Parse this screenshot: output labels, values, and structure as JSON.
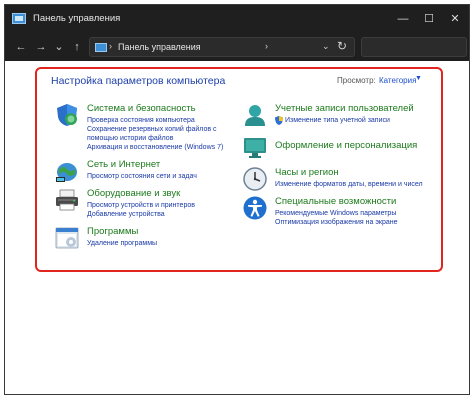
{
  "window": {
    "title": "Панель управления",
    "minimize_glyph": "—",
    "maximize_glyph": "☐",
    "close_glyph": "✕"
  },
  "nav": {
    "back_glyph": "←",
    "forward_glyph": "→",
    "recent_glyph": "⌄",
    "up_glyph": "↑",
    "breadcrumb": "Панель управления",
    "separator": "›",
    "dropdown_glyph": "⌄",
    "refresh_glyph": "↻"
  },
  "content": {
    "title": "Настройка параметров компьютера",
    "view_label": "Просмотр:",
    "view_value": "Категория",
    "view_arrow": "▼",
    "accent_color": "#e0261f"
  },
  "categories_left": [
    {
      "name": "system-security",
      "icon": "shield-icon",
      "title": "Система и безопасность",
      "links": [
        "Проверка состояния компьютера",
        "Сохранение резервных копий файлов с",
        "помощью истории файлов",
        "Архивация и восстановление (Windows 7)"
      ]
    },
    {
      "name": "network-internet",
      "icon": "network-icon",
      "title": "Сеть и Интернет",
      "links": [
        "Просмотр состояния сети и задач"
      ]
    },
    {
      "name": "hardware-sound",
      "icon": "printer-icon",
      "title": "Оборудование и звук",
      "links": [
        "Просмотр устройств и принтеров",
        "Добавление устройства"
      ]
    },
    {
      "name": "programs",
      "icon": "programs-icon",
      "title": "Программы",
      "links": [
        "Удаление программы"
      ]
    }
  ],
  "categories_right": [
    {
      "name": "user-accounts",
      "icon": "user-icon",
      "title": "Учетные записи пользователей",
      "links": [
        "Изменение типа учетной записи"
      ]
    },
    {
      "name": "appearance",
      "icon": "appearance-icon",
      "title": "Оформление и персонализация",
      "links": []
    },
    {
      "name": "clock-region",
      "icon": "clock-icon",
      "title": "Часы и регион",
      "links": [
        "Изменение форматов даты, времени и чисел"
      ]
    },
    {
      "name": "ease-of-access",
      "icon": "accessibility-icon",
      "title": "Специальные возможности",
      "links": [
        "Рекомендуемые Windows параметры",
        "Оптимизация изображения на экране"
      ]
    }
  ]
}
